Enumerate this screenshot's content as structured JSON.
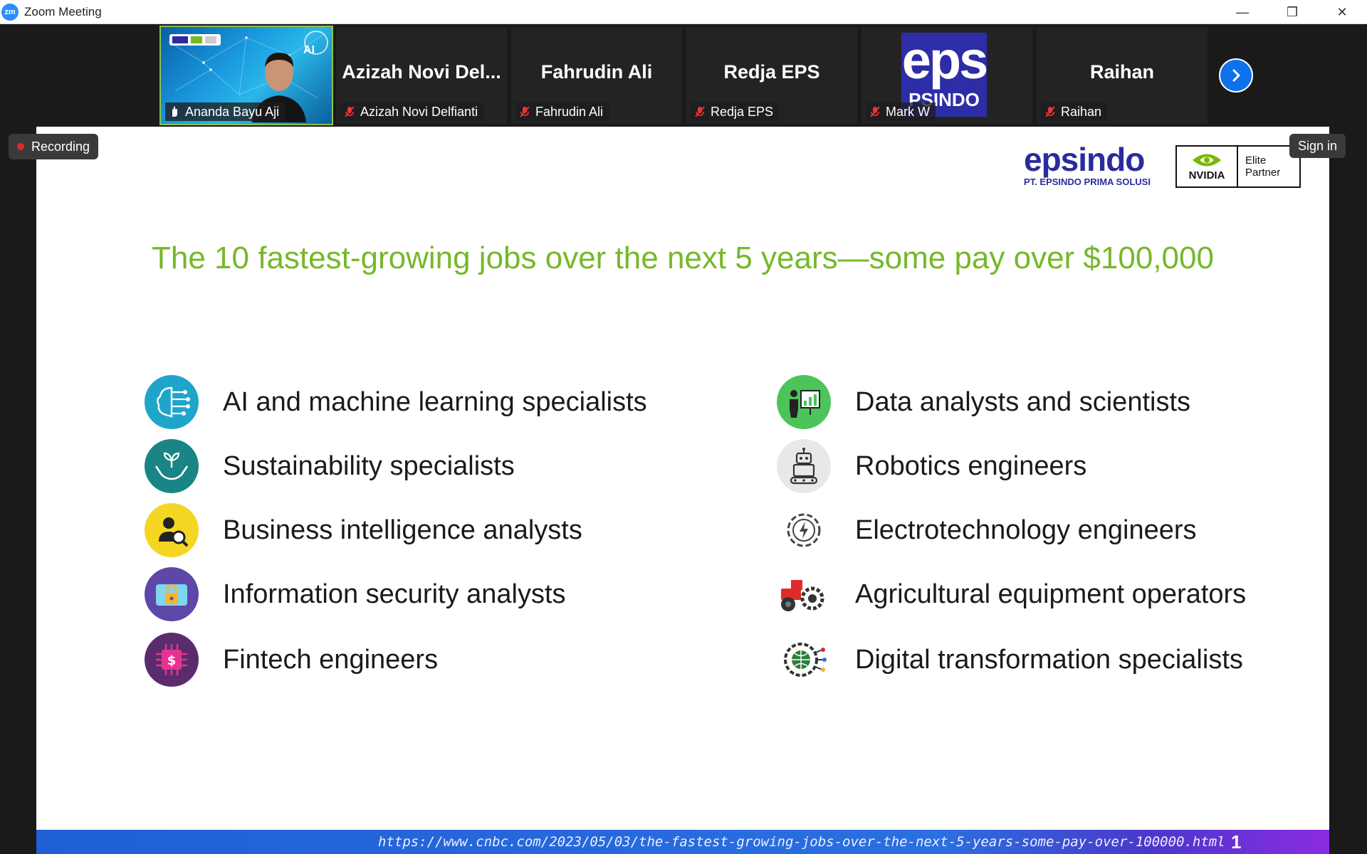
{
  "window": {
    "app_icon_text": "zm",
    "title": "Zoom Meeting",
    "minimize": "—",
    "restore": "❐",
    "close": "✕"
  },
  "participants": [
    {
      "name": "Ananda Bayu Aji",
      "display": "",
      "video": true
    },
    {
      "name": "Azizah Novi Delfianti",
      "display": "Azizah Novi Del..."
    },
    {
      "name": "Fahrudin Ali",
      "display": "Fahrudin Ali"
    },
    {
      "name": "Redja EPS",
      "display": "Redja EPS"
    },
    {
      "name": "Mark W",
      "display": "",
      "logo": "eps",
      "logo_sub": "PSINDO"
    },
    {
      "name": "Raihan",
      "display": "Raihan"
    }
  ],
  "active_tile_logo": "AI",
  "status": {
    "recording": "Recording",
    "sign_in": "Sign in"
  },
  "slide": {
    "logo_word": "epsindo",
    "logo_sub": "PT. EPSINDO PRIMA SOLUSI",
    "partner_brand": "NVIDIA",
    "partner_line1": "Elite",
    "partner_line2": "Partner",
    "title": "The 10 fastest-growing jobs over the next 5 years—some pay over $100,000",
    "jobs_left": [
      "AI and machine learning specialists",
      "Sustainability specialists",
      "Business intelligence analysts",
      "Information security analysts",
      "Fintech engineers"
    ],
    "jobs_right": [
      "Data analysts and scientists",
      "Robotics engineers",
      "Electrotechnology engineers",
      "Agricultural equipment operators",
      "Digital transformation specialists"
    ],
    "footer_url": "https://www.cnbc.com/2023/05/03/the-fastest-growing-jobs-over-the-next-5-years-some-pay-over-100000.html",
    "page_number": "1"
  },
  "colors": {
    "title_green": "#76b82a",
    "zoom_blue": "#0e72ed",
    "brand_navy": "#2b2b9e"
  }
}
